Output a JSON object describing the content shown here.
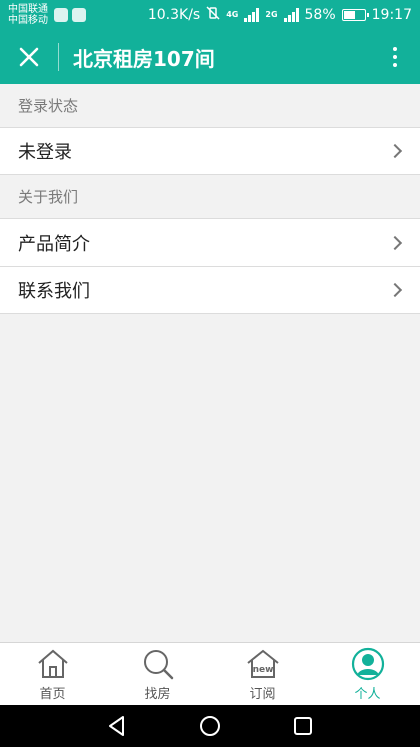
{
  "status_bar": {
    "carrier_1": "中国联通",
    "carrier_2": "中国移动",
    "net_speed": "10.3K/s",
    "net_tag_1": "4G",
    "net_tag_2": "2G",
    "battery": "58%",
    "battery_level": 0.58,
    "time": "19:17"
  },
  "app_bar": {
    "title": "北京租房107间",
    "close_icon": "close-icon",
    "more_icon": "more-vertical-icon"
  },
  "sections": [
    {
      "header": "登录状态",
      "items": [
        {
          "label": "未登录"
        }
      ]
    },
    {
      "header": "关于我们",
      "items": [
        {
          "label": "产品简介"
        },
        {
          "label": "联系我们"
        }
      ]
    }
  ],
  "bottom_nav": {
    "items": [
      {
        "label": "首页",
        "icon": "home-icon"
      },
      {
        "label": "找房",
        "icon": "search-icon"
      },
      {
        "label": "订阅",
        "icon": "subscribe-new-icon"
      },
      {
        "label": "个人",
        "icon": "user-icon",
        "active": true
      }
    ],
    "new_badge": "new"
  },
  "colors": {
    "accent": "#12b19a",
    "background": "#f2f2f2"
  }
}
